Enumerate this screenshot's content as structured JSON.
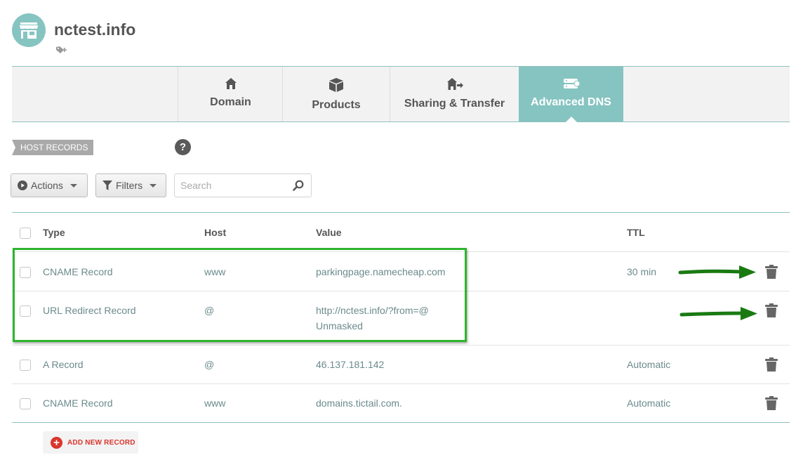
{
  "header": {
    "title": "nctest.info",
    "avatar_icon": "store-icon",
    "tag_icon": "tag-plus-icon"
  },
  "tabs": [
    {
      "label": "Domain",
      "icon": "home-icon"
    },
    {
      "label": "Products",
      "icon": "box-icon"
    },
    {
      "label": "Sharing & Transfer",
      "icon": "house-share-icon"
    },
    {
      "label": "Advanced DNS",
      "icon": "server-icon",
      "active": true
    }
  ],
  "section": {
    "label": "HOST RECORDS",
    "help": "?"
  },
  "toolbar": {
    "actions_label": "Actions",
    "filters_label": "Filters",
    "search_placeholder": "Search"
  },
  "table": {
    "columns": {
      "type": "Type",
      "host": "Host",
      "value": "Value",
      "ttl": "TTL"
    },
    "rows": [
      {
        "type": "CNAME Record",
        "host": "www",
        "value": "parkingpage.namecheap.com",
        "value2": "",
        "ttl": "30 min"
      },
      {
        "type": "URL Redirect Record",
        "host": "@",
        "value": "http://nctest.info/?from=@",
        "value2": "Unmasked",
        "ttl": ""
      },
      {
        "type": "A Record",
        "host": "@",
        "value": "46.137.181.142",
        "value2": "",
        "ttl": "Automatic"
      },
      {
        "type": "CNAME Record",
        "host": "www",
        "value": "domains.tictail.com.",
        "value2": "",
        "ttl": "Automatic"
      }
    ]
  },
  "add_record": {
    "label": "ADD NEW RECORD"
  },
  "colors": {
    "accent": "#86c4c1",
    "highlight": "#2db52d",
    "danger": "#d9352c"
  }
}
